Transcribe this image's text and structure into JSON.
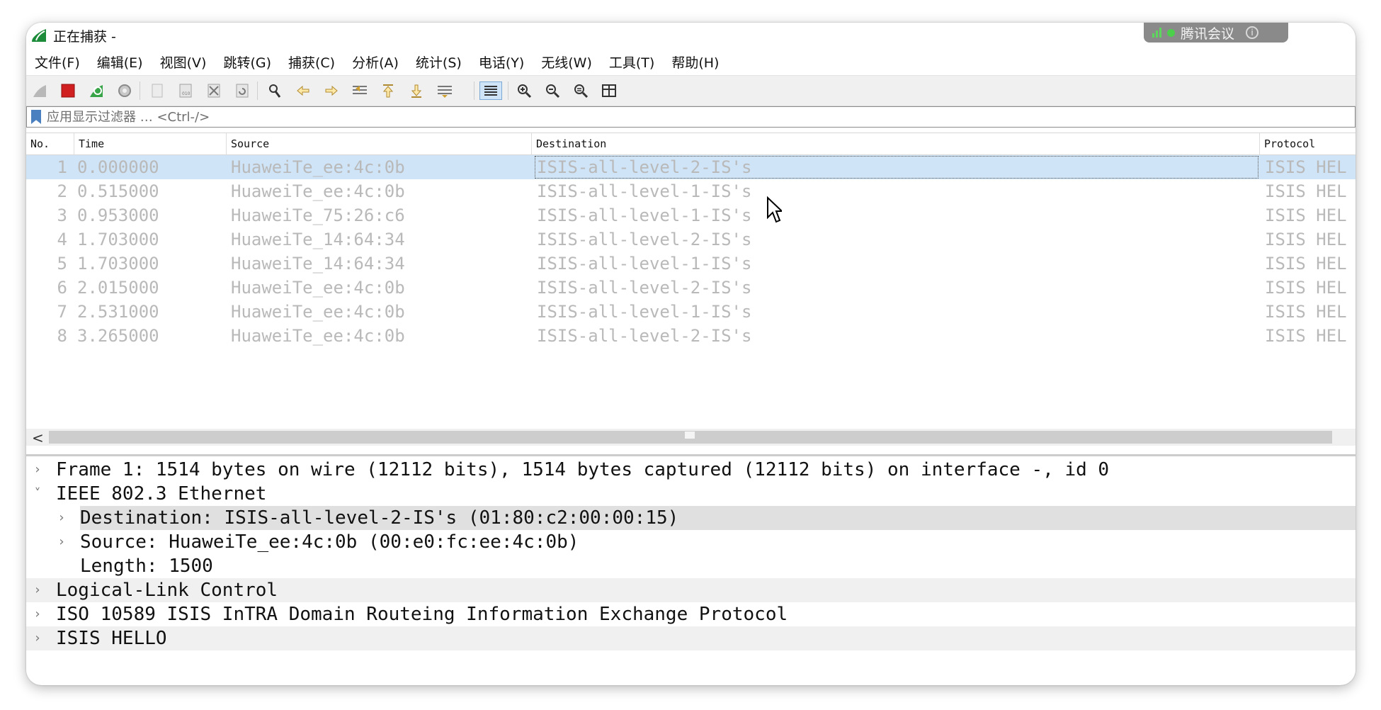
{
  "window": {
    "title": "正在捕获 -",
    "meeting_badge": "腾讯会议"
  },
  "menu": [
    "文件(F)",
    "编辑(E)",
    "视图(V)",
    "跳转(G)",
    "捕获(C)",
    "分析(A)",
    "统计(S)",
    "电话(Y)",
    "无线(W)",
    "工具(T)",
    "帮助(H)"
  ],
  "filter": {
    "placeholder": "应用显示过滤器 … <Ctrl-/>"
  },
  "packet_list": {
    "columns": [
      "No.",
      "Time",
      "Source",
      "Destination",
      "Protocol"
    ],
    "rows": [
      {
        "no": "1",
        "time": "0.000000",
        "source": "HuaweiTe_ee:4c:0b",
        "destination": "ISIS-all-level-2-IS's",
        "protocol": "ISIS HEL"
      },
      {
        "no": "2",
        "time": "0.515000",
        "source": "HuaweiTe_ee:4c:0b",
        "destination": "ISIS-all-level-1-IS's",
        "protocol": "ISIS HEL"
      },
      {
        "no": "3",
        "time": "0.953000",
        "source": "HuaweiTe_75:26:c6",
        "destination": "ISIS-all-level-1-IS's",
        "protocol": "ISIS HEL"
      },
      {
        "no": "4",
        "time": "1.703000",
        "source": "HuaweiTe_14:64:34",
        "destination": "ISIS-all-level-2-IS's",
        "protocol": "ISIS HEL"
      },
      {
        "no": "5",
        "time": "1.703000",
        "source": "HuaweiTe_14:64:34",
        "destination": "ISIS-all-level-1-IS's",
        "protocol": "ISIS HEL"
      },
      {
        "no": "6",
        "time": "2.015000",
        "source": "HuaweiTe_ee:4c:0b",
        "destination": "ISIS-all-level-2-IS's",
        "protocol": "ISIS HEL"
      },
      {
        "no": "7",
        "time": "2.531000",
        "source": "HuaweiTe_ee:4c:0b",
        "destination": "ISIS-all-level-1-IS's",
        "protocol": "ISIS HEL"
      },
      {
        "no": "8",
        "time": "3.265000",
        "source": "HuaweiTe_ee:4c:0b",
        "destination": "ISIS-all-level-2-IS's",
        "protocol": "ISIS HEL"
      }
    ]
  },
  "details": [
    {
      "arrow": "›",
      "text": "Frame 1: 1514 bytes on wire (12112 bits), 1514 bytes captured (12112 bits) on interface -, id 0"
    },
    {
      "arrow": "˅",
      "text": "IEEE 802.3 Ethernet"
    },
    {
      "arrow": "›",
      "text": "Destination: ISIS-all-level-2-IS's (01:80:c2:00:00:15)"
    },
    {
      "arrow": "›",
      "text": "Source: HuaweiTe_ee:4c:0b (00:e0:fc:ee:4c:0b)"
    },
    {
      "arrow": "",
      "text": "Length: 1500"
    },
    {
      "arrow": "›",
      "text": "Logical-Link Control"
    },
    {
      "arrow": "›",
      "text": "ISO 10589 ISIS InTRA Domain Routeing Information Exchange Protocol"
    },
    {
      "arrow": "›",
      "text": "ISIS HELLO"
    }
  ],
  "scrollbar": {
    "left_arrow": "<"
  },
  "colors": {
    "selection": "#cfe4f7",
    "row_text": "#b9b9b9",
    "accent": "#4a7fc0"
  }
}
